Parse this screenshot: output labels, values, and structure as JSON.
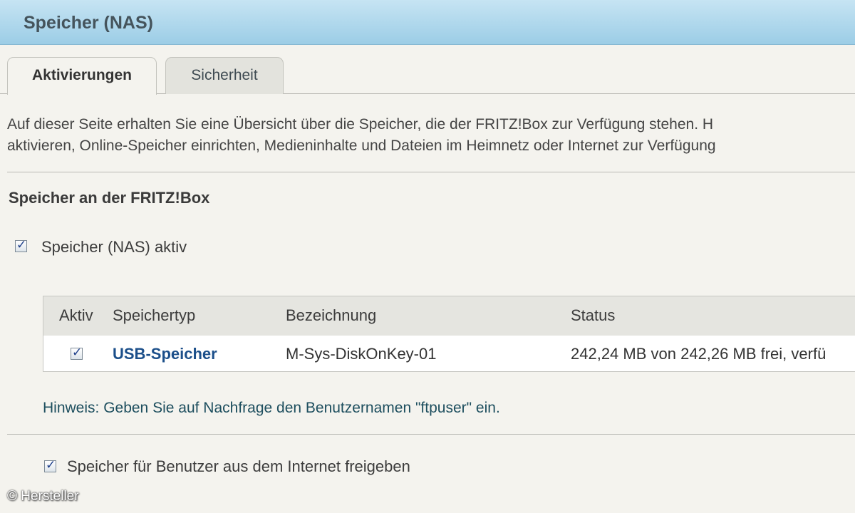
{
  "header": {
    "title": "Speicher (NAS)"
  },
  "tabs": [
    {
      "label": "Aktivierungen",
      "active": true
    },
    {
      "label": "Sicherheit",
      "active": false
    }
  ],
  "intro": {
    "line1": "Auf dieser Seite erhalten Sie eine Übersicht über die Speicher, die der FRITZ!Box zur Verfügung stehen. H",
    "line2": "aktivieren, Online-Speicher einrichten, Medieninhalte und Dateien im Heimnetz oder Internet zur Verfügung"
  },
  "section": {
    "title": "Speicher an der FRITZ!Box"
  },
  "nas_active": {
    "label": "Speicher (NAS) aktiv",
    "checked": true
  },
  "table": {
    "headers": {
      "aktiv": "Aktiv",
      "typ": "Speichertyp",
      "bezeichnung": "Bezeichnung",
      "status": "Status"
    },
    "rows": [
      {
        "checked": true,
        "typ": "USB-Speicher",
        "bezeichnung": "M-Sys-DiskOnKey-01",
        "status": "242,24 MB von 242,26 MB frei, verfü"
      }
    ]
  },
  "hint": {
    "text": "Hinweis: Geben Sie auf Nachfrage den Benutzernamen \"ftpuser\" ein."
  },
  "internet_share": {
    "label": "Speicher für Benutzer aus dem Internet freigeben",
    "checked": true
  },
  "credit": {
    "text": "© Hersteller"
  },
  "colors": {
    "header_bg": "#9ccde6",
    "link": "#1c4f8a",
    "hint": "#1d4e5e",
    "check": "#1e3f8a"
  },
  "check_glyph": "✓"
}
